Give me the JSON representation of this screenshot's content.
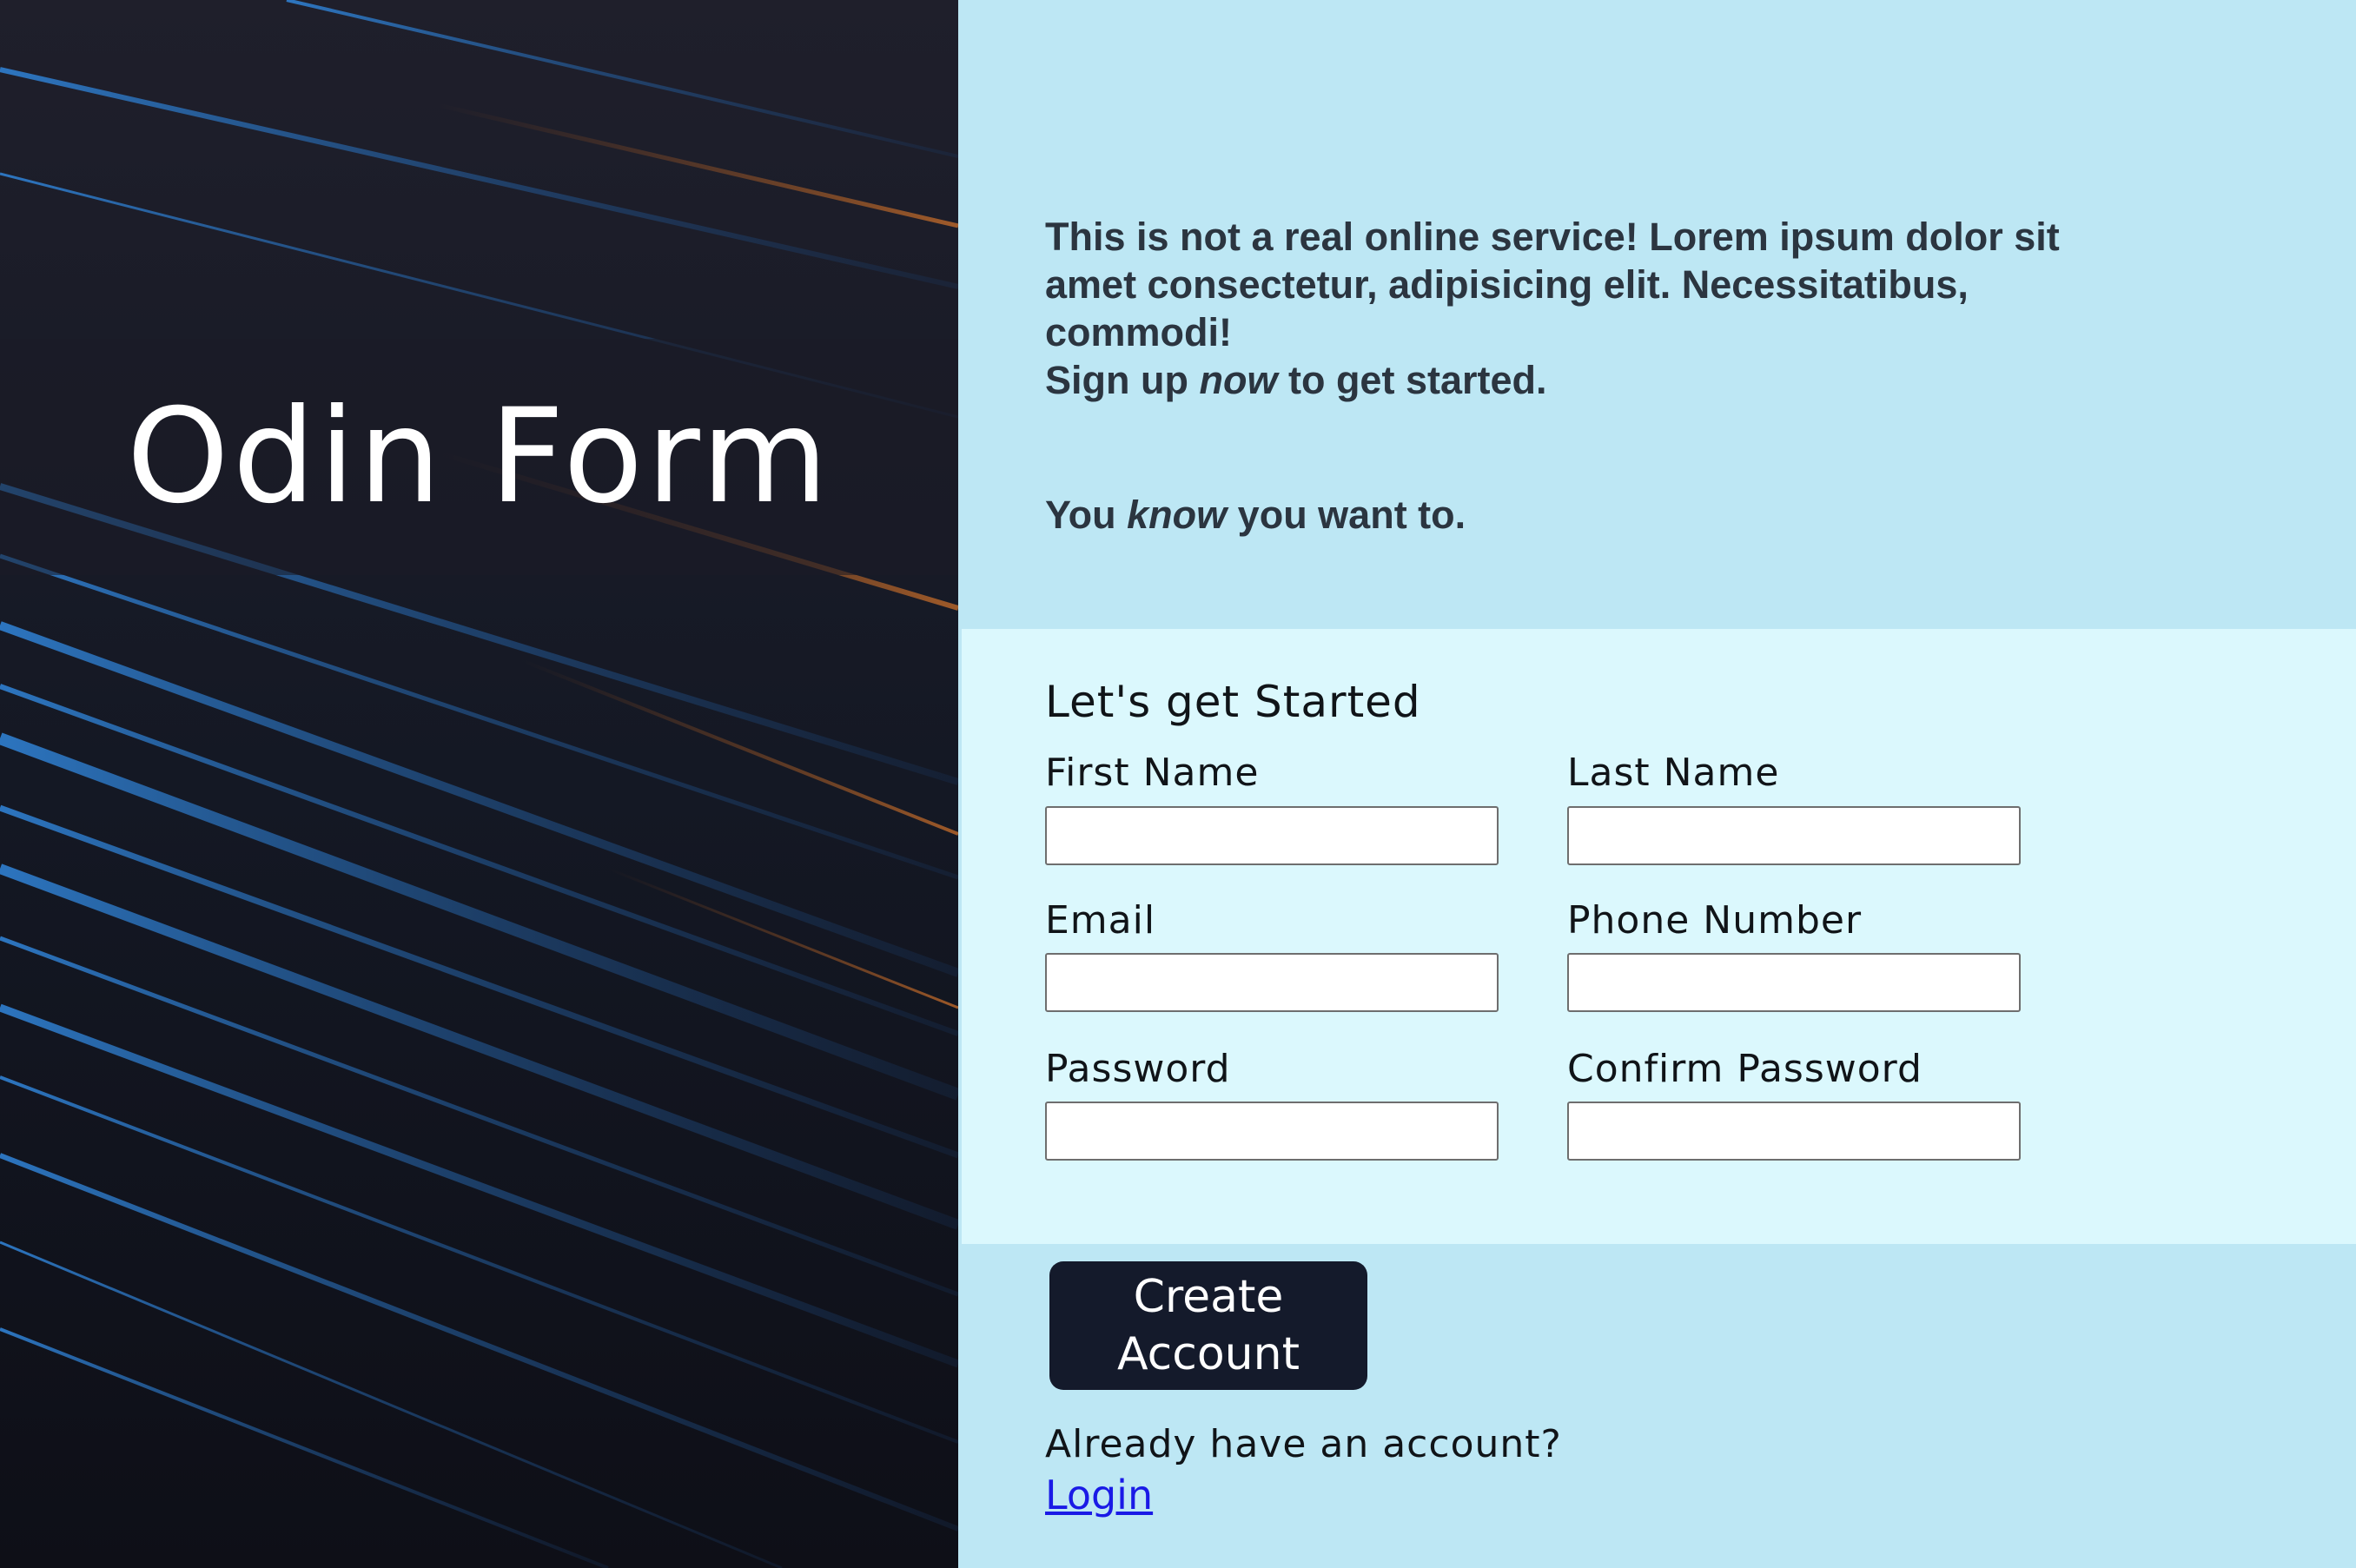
{
  "brand": {
    "title": "Odin Form"
  },
  "intro": {
    "line1": "This is not a real online service! Lorem ipsum dolor sit amet consectetur, adipisicing elit. Necessitatibus, commodi!",
    "line2_pre": "Sign up ",
    "line2_em": "now",
    "line2_post": " to get started.",
    "line3_pre": "You ",
    "line3_em": "know",
    "line3_post": " you want to."
  },
  "form": {
    "heading": "Let's get Started",
    "first_name_label": "First Name",
    "first_name_value": "",
    "last_name_label": "Last Name",
    "last_name_value": "",
    "email_label": "Email",
    "email_value": "",
    "phone_label": "Phone Number",
    "phone_value": "",
    "password_label": "Password",
    "password_value": "",
    "confirm_password_label": "Confirm Password",
    "confirm_password_value": ""
  },
  "actions": {
    "create_button_label": "Create Account",
    "login_prompt": "Already have an account?",
    "login_link": "Login"
  },
  "colors": {
    "left_panel_bg": "#15151f",
    "right_panel_bg": "#bde7f4",
    "form_section_bg": "#dbf8fd",
    "button_bg": "#141a2b",
    "link": "#1a1ae6"
  }
}
